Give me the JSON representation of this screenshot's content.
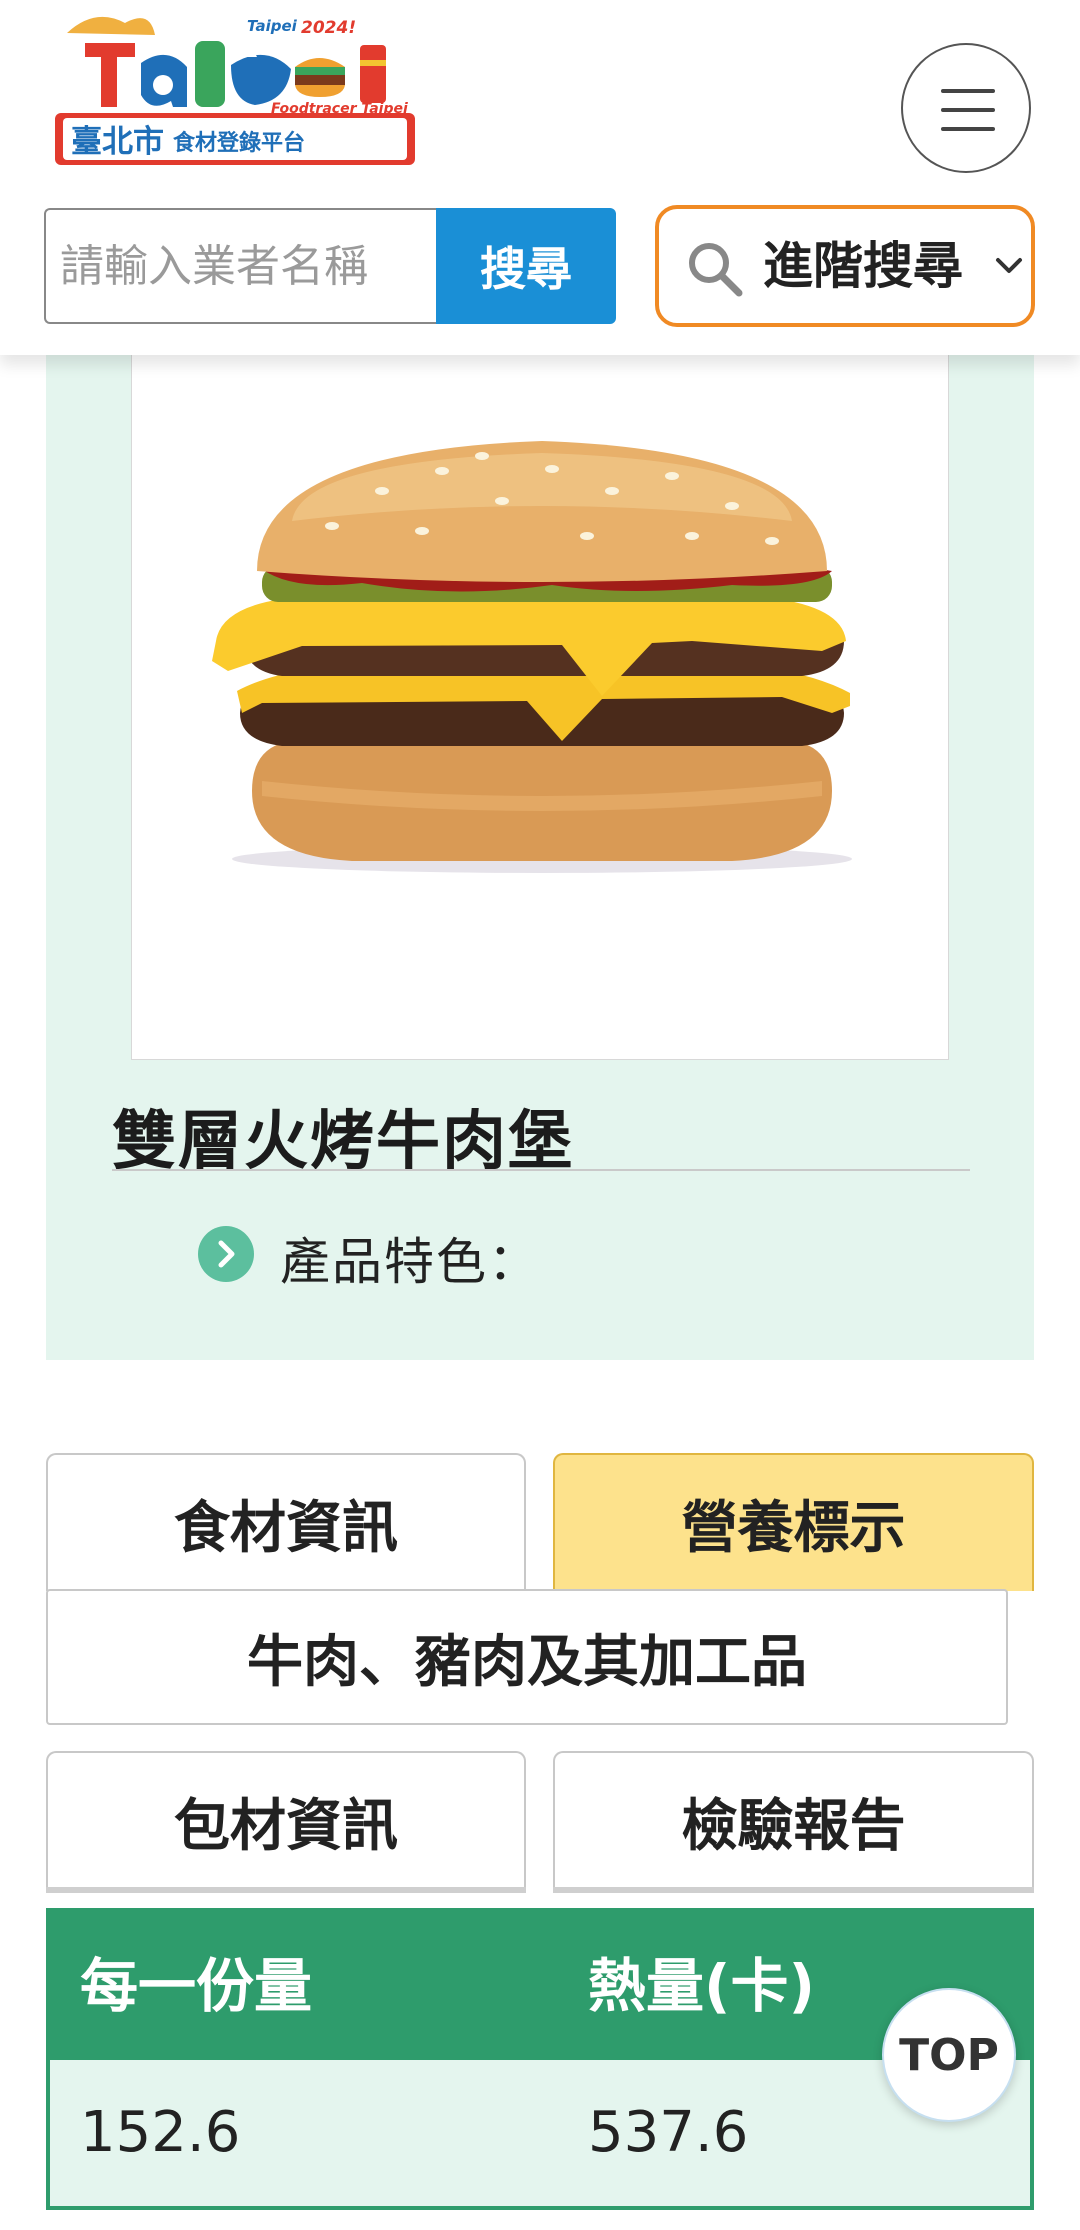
{
  "header": {
    "logo": {
      "title": "臺北市食材登錄平台",
      "subtitle_en": "Foodtracer Taipei",
      "badge": "Taipei 2024!"
    },
    "search": {
      "placeholder": "請輸入業者名稱",
      "button_label": "搜尋"
    },
    "advanced_search_label": "進階搜尋"
  },
  "product": {
    "name": "雙層火烤牛肉堡",
    "feature_label": "產品特色："
  },
  "tabs": [
    {
      "label": "食材資訊",
      "active": false
    },
    {
      "label": "營養標示",
      "active": true
    },
    {
      "label": "牛肉、豬肉及其加工品",
      "active": false
    },
    {
      "label": "包材資訊",
      "active": false
    },
    {
      "label": "檢驗報告",
      "active": false
    }
  ],
  "nutrition_table": {
    "headers": [
      "每一份量",
      "熱量(卡)"
    ],
    "rows": [
      [
        "152.6",
        "537.6"
      ]
    ]
  },
  "top_button_label": "TOP",
  "colors": {
    "search_button": "#1a8fd6",
    "advanced_border": "#f08a24",
    "card_bg": "#e4f5ee",
    "active_tab": "#fde28c",
    "table_header": "#2e9c6c"
  }
}
